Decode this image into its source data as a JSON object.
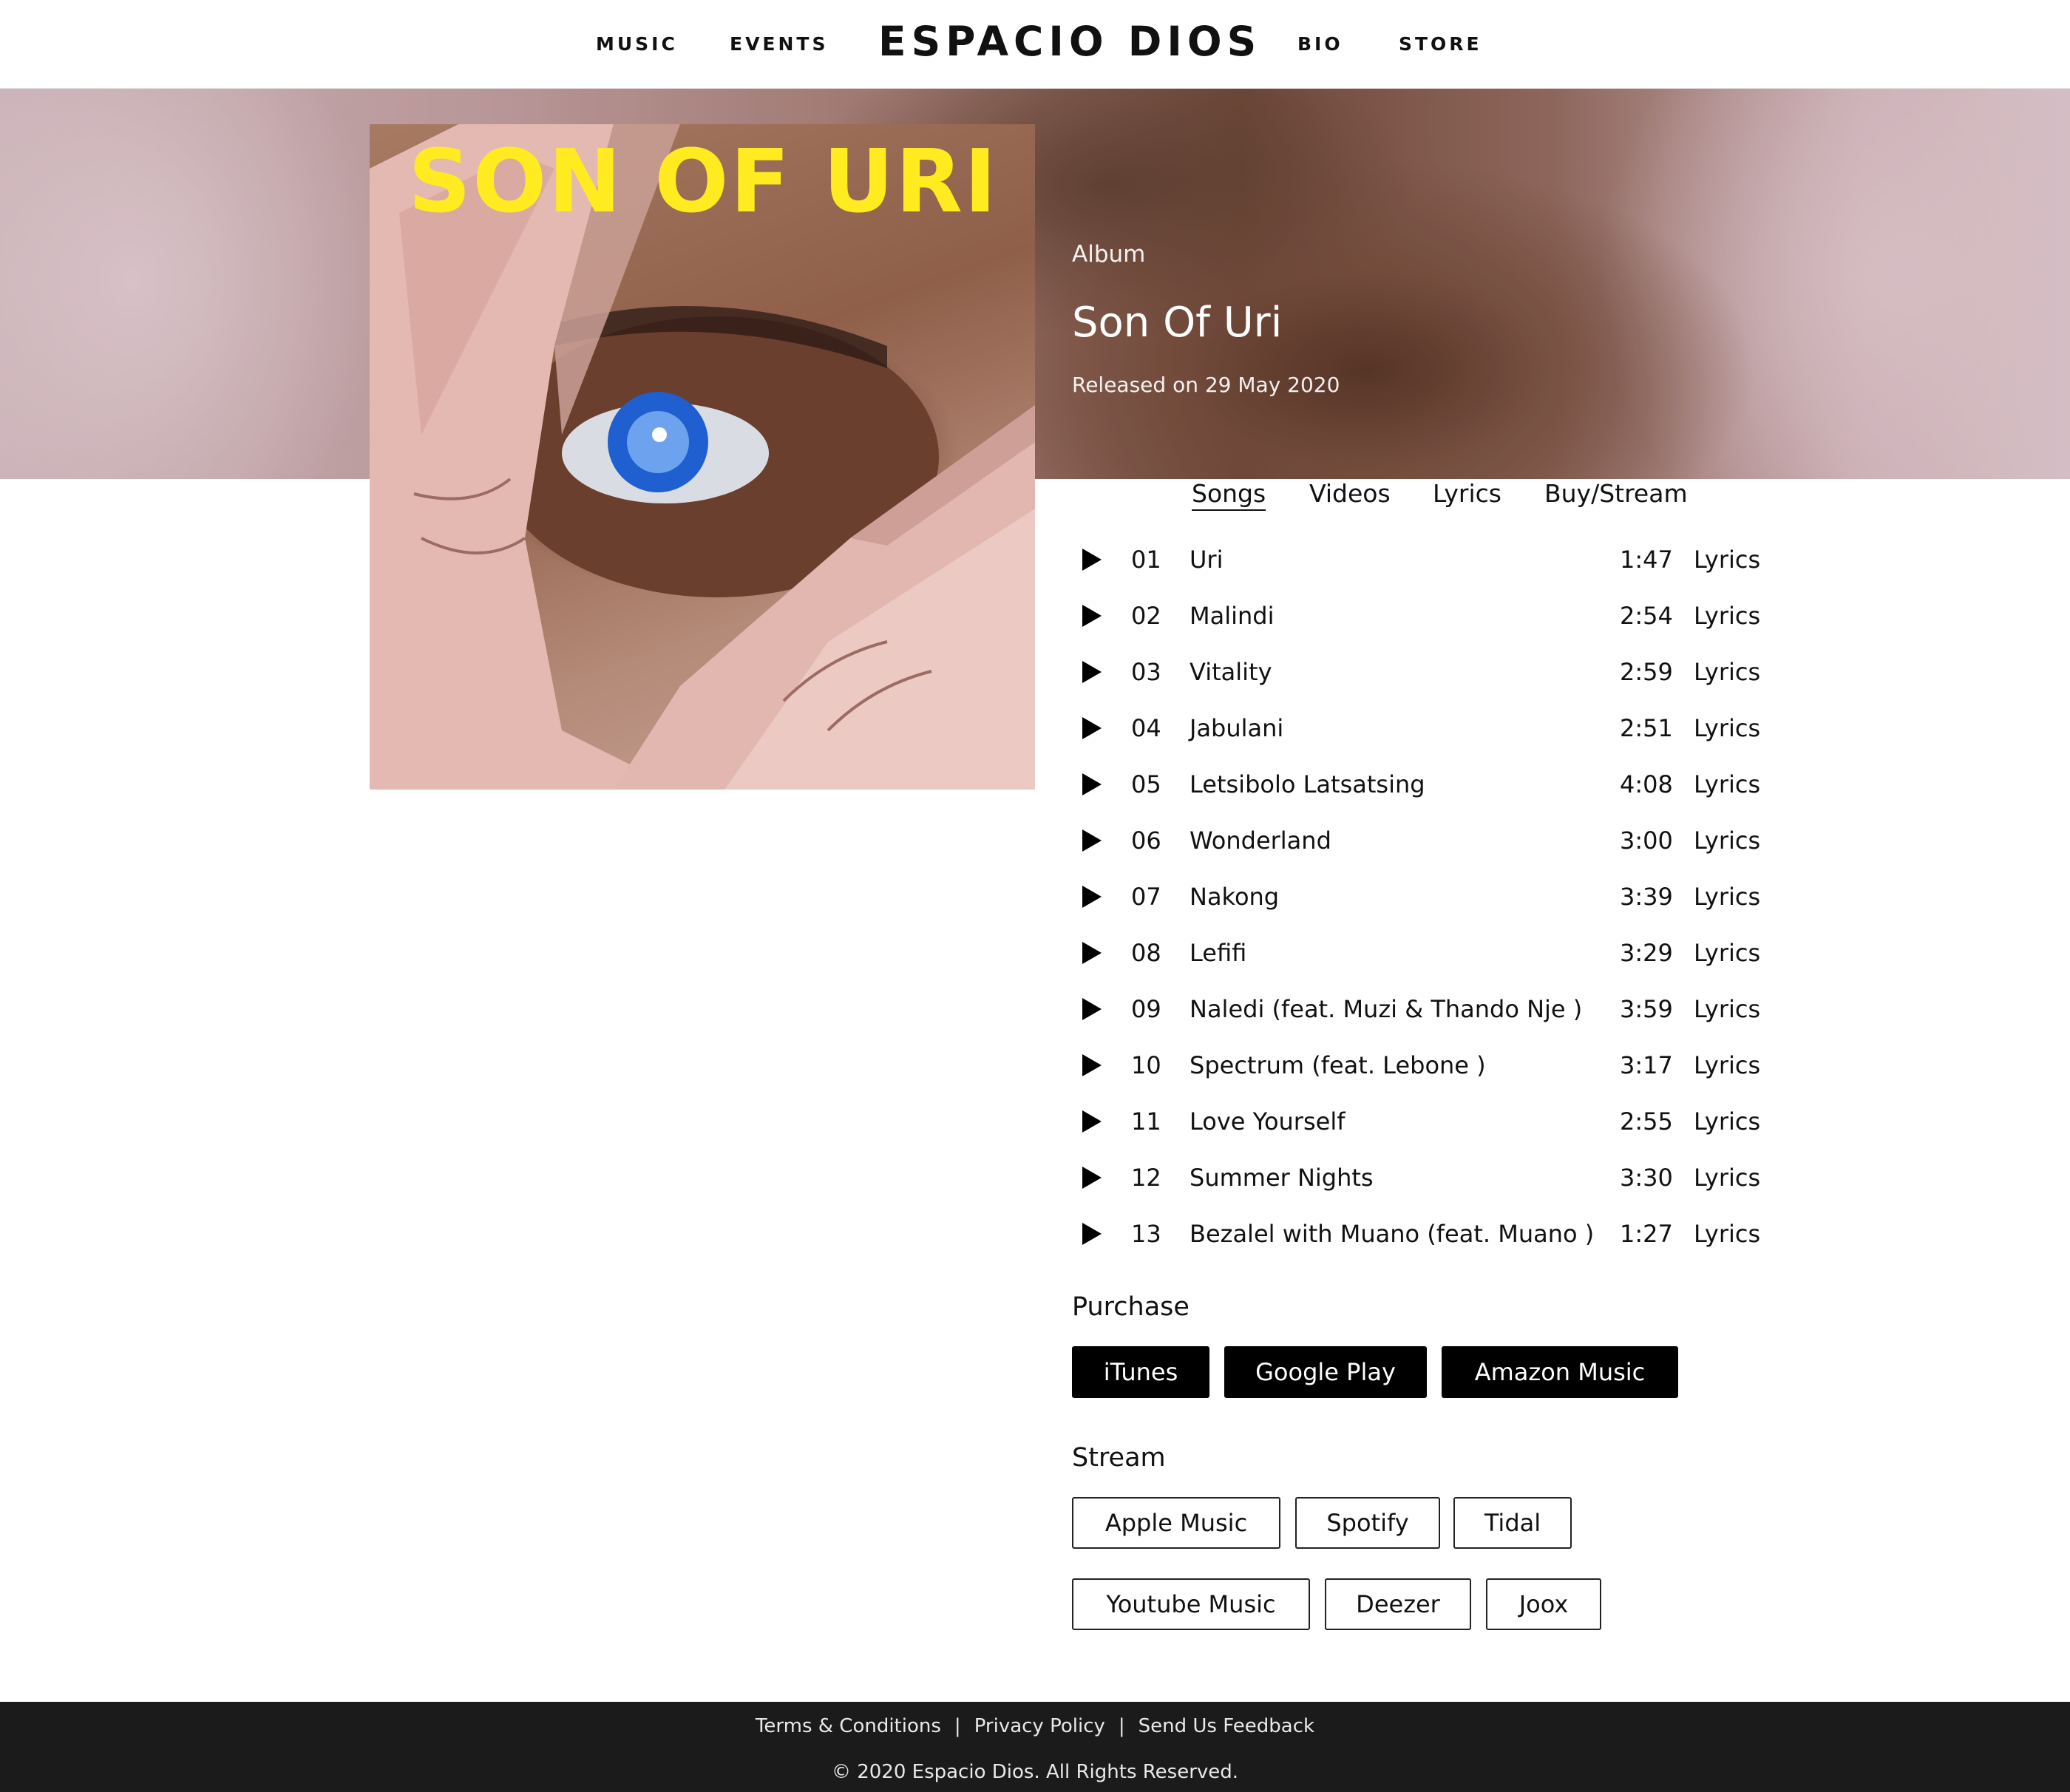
{
  "nav": {
    "brand": "ESPACIO DIOS",
    "links": [
      "MUSIC",
      "EVENTS",
      "BIO",
      "STORE"
    ]
  },
  "album": {
    "kind": "Album",
    "title": "Son Of Uri",
    "released": "Released on 29 May 2020",
    "cover_text": "SON OF URI"
  },
  "tabs": [
    {
      "label": "Songs",
      "active": true
    },
    {
      "label": "Videos",
      "active": false
    },
    {
      "label": "Lyrics",
      "active": false
    },
    {
      "label": "Buy/Stream",
      "active": false
    }
  ],
  "tracks": [
    {
      "num": "01",
      "title": "Uri",
      "duration": "1:47",
      "lyrics": "Lyrics"
    },
    {
      "num": "02",
      "title": "Malindi",
      "duration": "2:54",
      "lyrics": "Lyrics"
    },
    {
      "num": "03",
      "title": "Vitality",
      "duration": "2:59",
      "lyrics": "Lyrics"
    },
    {
      "num": "04",
      "title": "Jabulani",
      "duration": "2:51",
      "lyrics": "Lyrics"
    },
    {
      "num": "05",
      "title": "Letsibolo Latsatsing",
      "duration": "4:08",
      "lyrics": "Lyrics"
    },
    {
      "num": "06",
      "title": "Wonderland",
      "duration": "3:00",
      "lyrics": "Lyrics"
    },
    {
      "num": "07",
      "title": "Nakong",
      "duration": "3:39",
      "lyrics": "Lyrics"
    },
    {
      "num": "08",
      "title": "Lefifi",
      "duration": "3:29",
      "lyrics": "Lyrics"
    },
    {
      "num": "09",
      "title": "Naledi (feat. Muzi & Thando Nje )",
      "duration": "3:59",
      "lyrics": "Lyrics"
    },
    {
      "num": "10",
      "title": "Spectrum (feat. Lebone )",
      "duration": "3:17",
      "lyrics": "Lyrics"
    },
    {
      "num": "11",
      "title": "Love Yourself",
      "duration": "2:55",
      "lyrics": "Lyrics"
    },
    {
      "num": "12",
      "title": "Summer Nights",
      "duration": "3:30",
      "lyrics": "Lyrics"
    },
    {
      "num": "13",
      "title": "Bezalel with Muano (feat. Muano )",
      "duration": "1:27",
      "lyrics": "Lyrics"
    }
  ],
  "purchase": {
    "heading": "Purchase",
    "buttons": [
      "iTunes",
      "Google Play",
      "Amazon Music"
    ]
  },
  "stream": {
    "heading": "Stream",
    "buttons": [
      "Apple Music",
      "Spotify",
      "Tidal",
      "Youtube Music",
      "Deezer",
      "Joox"
    ]
  },
  "footer": {
    "links": [
      "Terms & Conditions",
      "Privacy Policy",
      "Send Us Feedback"
    ],
    "separator": "|",
    "copyright": "© 2020 Espacio Dios. All Rights Reserved."
  },
  "colors": {
    "accent": "#000000",
    "footer_bg": "#1b1b1b",
    "cover_text": "#ffeb1f"
  },
  "icons": {
    "play": "play-icon"
  }
}
